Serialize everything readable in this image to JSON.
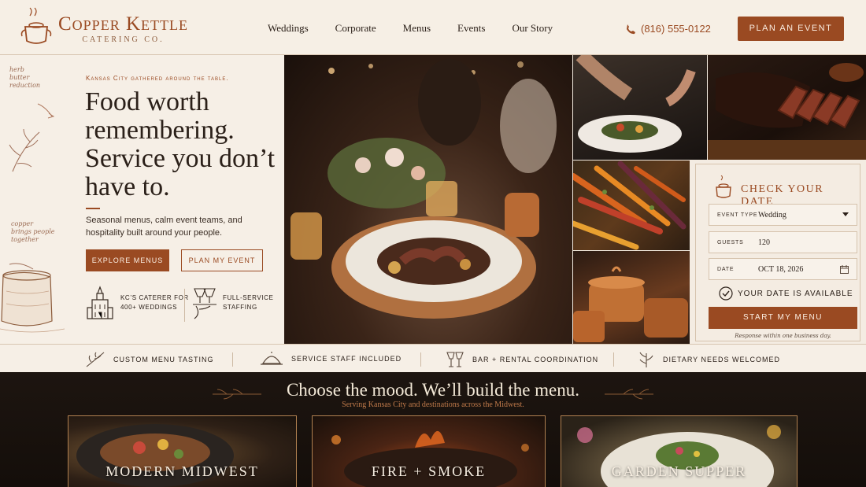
{
  "brand": {
    "name": "Copper Kettle",
    "sub": "CATERING CO."
  },
  "nav": [
    "Weddings",
    "Corporate",
    "Menus",
    "Events",
    "Our Story"
  ],
  "phone": "(816) 555-0122",
  "header_cta": "PLAN AN EVENT",
  "hero": {
    "kicker": "Kansas City gathered around the table.",
    "headline": "Food worth remembering. Service you don’t have to.",
    "sub": "Seasonal menus, calm event teams, and hospitality built around your people.",
    "btn_explore": "EXPLORE MENUS",
    "btn_plan": "PLAN MY EVENT",
    "cred1": "KC’S CATERER FOR\n400+ WEDDINGS",
    "cred2": "FULL-SERVICE\nSTAFFING",
    "note_top": "herb\nbutter\nreduction",
    "note_bottom": "copper\nbrings people\ntogether"
  },
  "booking": {
    "title": "CHECK YOUR DATE",
    "event_type_label": "EVENT TYPE",
    "event_type_value": "Wedding",
    "guests_label": "GUESTS",
    "guests_value": "120",
    "date_label": "DATE",
    "date_value": "OCT 18, 2026",
    "availability": "YOUR DATE IS AVAILABLE",
    "cta": "START MY MENU",
    "note": "Response within one business day."
  },
  "features": [
    "CUSTOM MENU TASTING",
    "SERVICE STAFF INCLUDED",
    "BAR + RENTAL COORDINATION",
    "DIETARY NEEDS WELCOMED"
  ],
  "mood": {
    "title": "Choose the mood. We’ll build the menu.",
    "sub": "Serving Kansas City and destinations across the Midwest.",
    "cards": [
      "MODERN MIDWEST",
      "FIRE + SMOKE",
      "GARDEN SUPPER"
    ]
  },
  "colors": {
    "accent": "#9a4a22",
    "cream": "#f4ece1",
    "dark": "#1d1510"
  },
  "icons": [
    "kettle-icon",
    "phone-icon",
    "cloche-icon",
    "check-circle-icon",
    "calendar-icon",
    "chevron-down-icon",
    "sprig-icon",
    "glasses-icon",
    "building-icon",
    "waiter-icon"
  ]
}
